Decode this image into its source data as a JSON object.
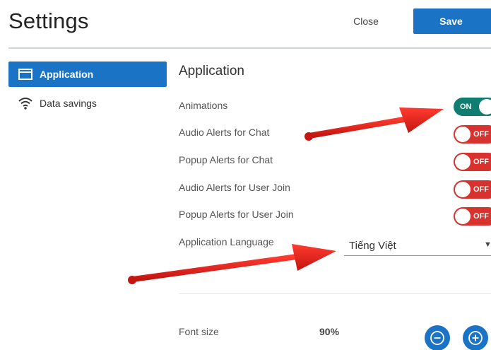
{
  "header": {
    "title": "Settings",
    "close_label": "Close",
    "save_label": "Save"
  },
  "sidebar": {
    "items": [
      {
        "label": "Application",
        "icon": "window-icon",
        "active": true
      },
      {
        "label": "Data savings",
        "icon": "wifi-icon",
        "active": false
      }
    ]
  },
  "main": {
    "section_title": "Application",
    "settings": [
      {
        "label": "Animations",
        "state": "ON"
      },
      {
        "label": "Audio Alerts for Chat",
        "state": "OFF"
      },
      {
        "label": "Popup Alerts for Chat",
        "state": "OFF"
      },
      {
        "label": "Audio Alerts for User Join",
        "state": "OFF"
      },
      {
        "label": "Popup Alerts for User Join",
        "state": "OFF"
      }
    ],
    "language": {
      "label": "Application Language",
      "selected": "Tiếng Việt"
    },
    "font_size": {
      "label": "Font size",
      "value": "90%"
    }
  },
  "colors": {
    "primary": "#1a73c5",
    "toggle_on": "#0f7d6f",
    "toggle_off": "#d7322d",
    "annotation_arrow": "#e0201b"
  }
}
